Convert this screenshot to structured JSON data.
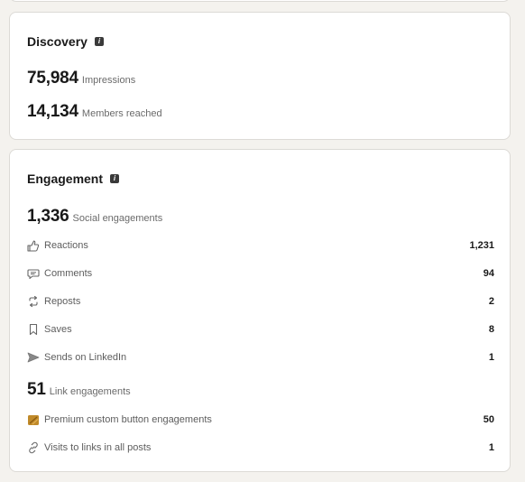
{
  "discovery": {
    "title": "Discovery",
    "impressions": {
      "value": "75,984",
      "label": "Impressions"
    },
    "members_reached": {
      "value": "14,134",
      "label": "Members reached"
    }
  },
  "engagement": {
    "title": "Engagement",
    "social": {
      "value": "1,336",
      "label": "Social engagements"
    },
    "social_items": [
      {
        "icon": "thumbs-up-icon",
        "label": "Reactions",
        "value": "1,231"
      },
      {
        "icon": "comment-icon",
        "label": "Comments",
        "value": "94"
      },
      {
        "icon": "repost-icon",
        "label": "Reposts",
        "value": "2"
      },
      {
        "icon": "bookmark-icon",
        "label": "Saves",
        "value": "8"
      },
      {
        "icon": "send-icon",
        "label": "Sends on LinkedIn",
        "value": "1"
      }
    ],
    "link": {
      "value": "51",
      "label": "Link engagements"
    },
    "link_items": [
      {
        "icon": "premium-icon",
        "label": "Premium custom button engagements",
        "value": "50"
      },
      {
        "icon": "link-icon",
        "label": "Visits to links in all posts",
        "value": "1"
      }
    ]
  }
}
